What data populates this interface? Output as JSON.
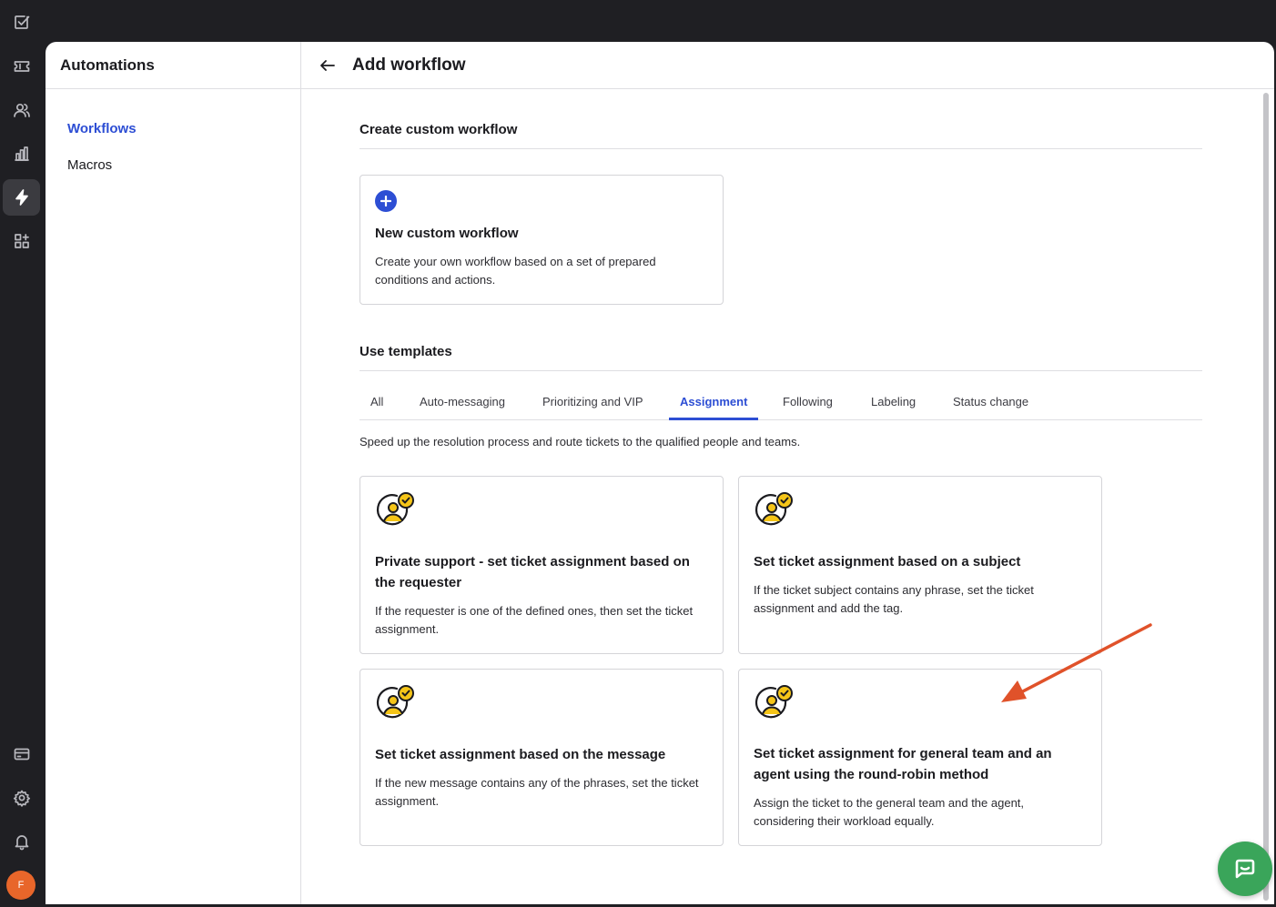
{
  "rail": {
    "items": [
      "logo",
      "tickets",
      "contacts",
      "reports",
      "automations",
      "apps"
    ],
    "bottom": [
      "billing",
      "settings",
      "notifications"
    ],
    "avatar_initial": "F"
  },
  "sidebar": {
    "title": "Automations",
    "items": [
      {
        "label": "Workflows",
        "active": true
      },
      {
        "label": "Macros",
        "active": false
      }
    ]
  },
  "header": {
    "title": "Add workflow"
  },
  "custom": {
    "section_title": "Create custom workflow",
    "card_title": "New custom workflow",
    "card_desc": "Create your own workflow based on a set of prepared conditions and actions."
  },
  "templates": {
    "section_title": "Use templates",
    "tabs": [
      "All",
      "Auto-messaging",
      "Prioritizing and VIP",
      "Assignment",
      "Following",
      "Labeling",
      "Status change"
    ],
    "active_tab": "Assignment",
    "description": "Speed up the resolution process and route tickets to the qualified people and teams.",
    "cards": [
      {
        "title": "Private support - set ticket assignment based on the requester",
        "desc": "If the requester is one of the defined ones, then set the ticket assignment."
      },
      {
        "title": "Set ticket assignment based on a subject",
        "desc": "If the ticket subject contains any phrase, set the ticket assignment and add the tag."
      },
      {
        "title": "Set ticket assignment based on the message",
        "desc": "If the new message contains any of the phrases, set the ticket assignment."
      },
      {
        "title": "Set ticket assignment for general team and an agent using the round-robin method",
        "desc": "Assign the ticket to the general team and the agent, considering their workload equally."
      }
    ]
  },
  "colors": {
    "accent": "#2d4ed4",
    "annotation_arrow": "#e0522a",
    "chat_button": "#3aa55a",
    "icon_yellow": "#f5c518"
  }
}
